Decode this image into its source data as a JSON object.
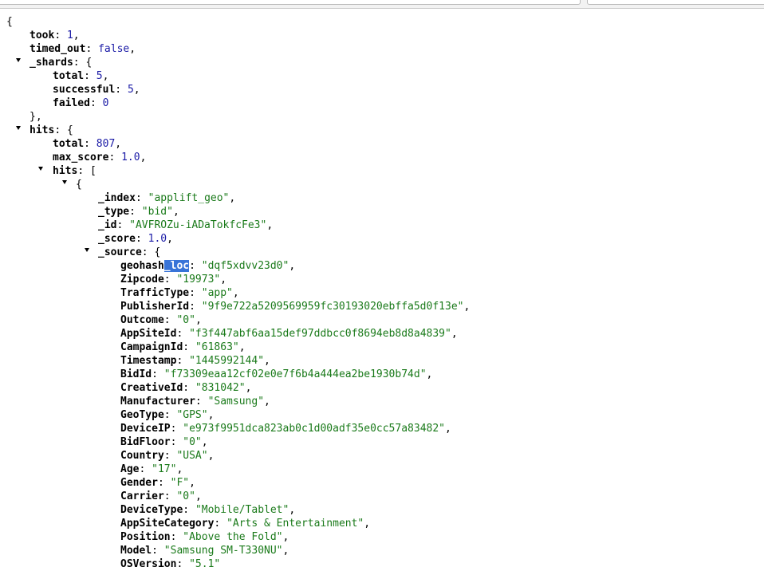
{
  "punct": {
    "open_brace": "{",
    "close_brace_comma": "},",
    "open_bracket": "[",
    "colon": ": ",
    "comma": ",",
    "open": " {"
  },
  "root": {
    "took_key": "took",
    "took_val": "1",
    "timed_out_key": "timed_out",
    "timed_out_val": "false",
    "shards_key": "_shards",
    "shards": {
      "total_key": "total",
      "total_val": "5",
      "successful_key": "successful",
      "successful_val": "5",
      "failed_key": "failed",
      "failed_val": "0"
    },
    "hits_key": "hits",
    "hits": {
      "total_key": "total",
      "total_val": "807",
      "max_score_key": "max_score",
      "max_score_val": "1.0",
      "hits_key": "hits",
      "doc": {
        "index_key": "_index",
        "index_val": "\"applift_geo\"",
        "type_key": "_type",
        "type_val": "\"bid\"",
        "id_key": "_id",
        "id_val": "\"AVFROZu-iADaTokfcFe3\"",
        "score_key": "_score",
        "score_val": "1.0",
        "source_key": "_source",
        "source": [
          {
            "key": "geohash",
            "key_hl": "_loc",
            "value": "\"dqf5xdvv23d0\""
          },
          {
            "key": "Zipcode",
            "value": "\"19973\""
          },
          {
            "key": "TrafficType",
            "value": "\"app\""
          },
          {
            "key": "PublisherId",
            "value": "\"9f9e722a5209569959fc30193020ebffa5d0f13e\""
          },
          {
            "key": "Outcome",
            "value": "\"0\""
          },
          {
            "key": "AppSiteId",
            "value": "\"f3f447abf6aa15def97ddbcc0f8694eb8d8a4839\""
          },
          {
            "key": "CampaignId",
            "value": "\"61863\""
          },
          {
            "key": "Timestamp",
            "value": "\"1445992144\""
          },
          {
            "key": "BidId",
            "value": "\"f73309eaa12cf02e0e7f6b4a444ea2be1930b74d\""
          },
          {
            "key": "CreativeId",
            "value": "\"831042\""
          },
          {
            "key": "Manufacturer",
            "value": "\"Samsung\""
          },
          {
            "key": "GeoType",
            "value": "\"GPS\""
          },
          {
            "key": "DeviceIP",
            "value": "\"e973f9951dca823ab0c1d00adf35e0cc57a83482\""
          },
          {
            "key": "BidFloor",
            "value": "\"0\""
          },
          {
            "key": "Country",
            "value": "\"USA\""
          },
          {
            "key": "Age",
            "value": "\"17\""
          },
          {
            "key": "Gender",
            "value": "\"F\""
          },
          {
            "key": "Carrier",
            "value": "\"0\""
          },
          {
            "key": "DeviceType",
            "value": "\"Mobile/Tablet\""
          },
          {
            "key": "AppSiteCategory",
            "value": "\"Arts & Entertainment\""
          },
          {
            "key": "Position",
            "value": "\"Above the Fold\""
          },
          {
            "key": "Model",
            "value": "\"Samsung SM-T330NU\""
          },
          {
            "key": "OSVersion",
            "value": "\"5.1\""
          }
        ]
      }
    }
  }
}
